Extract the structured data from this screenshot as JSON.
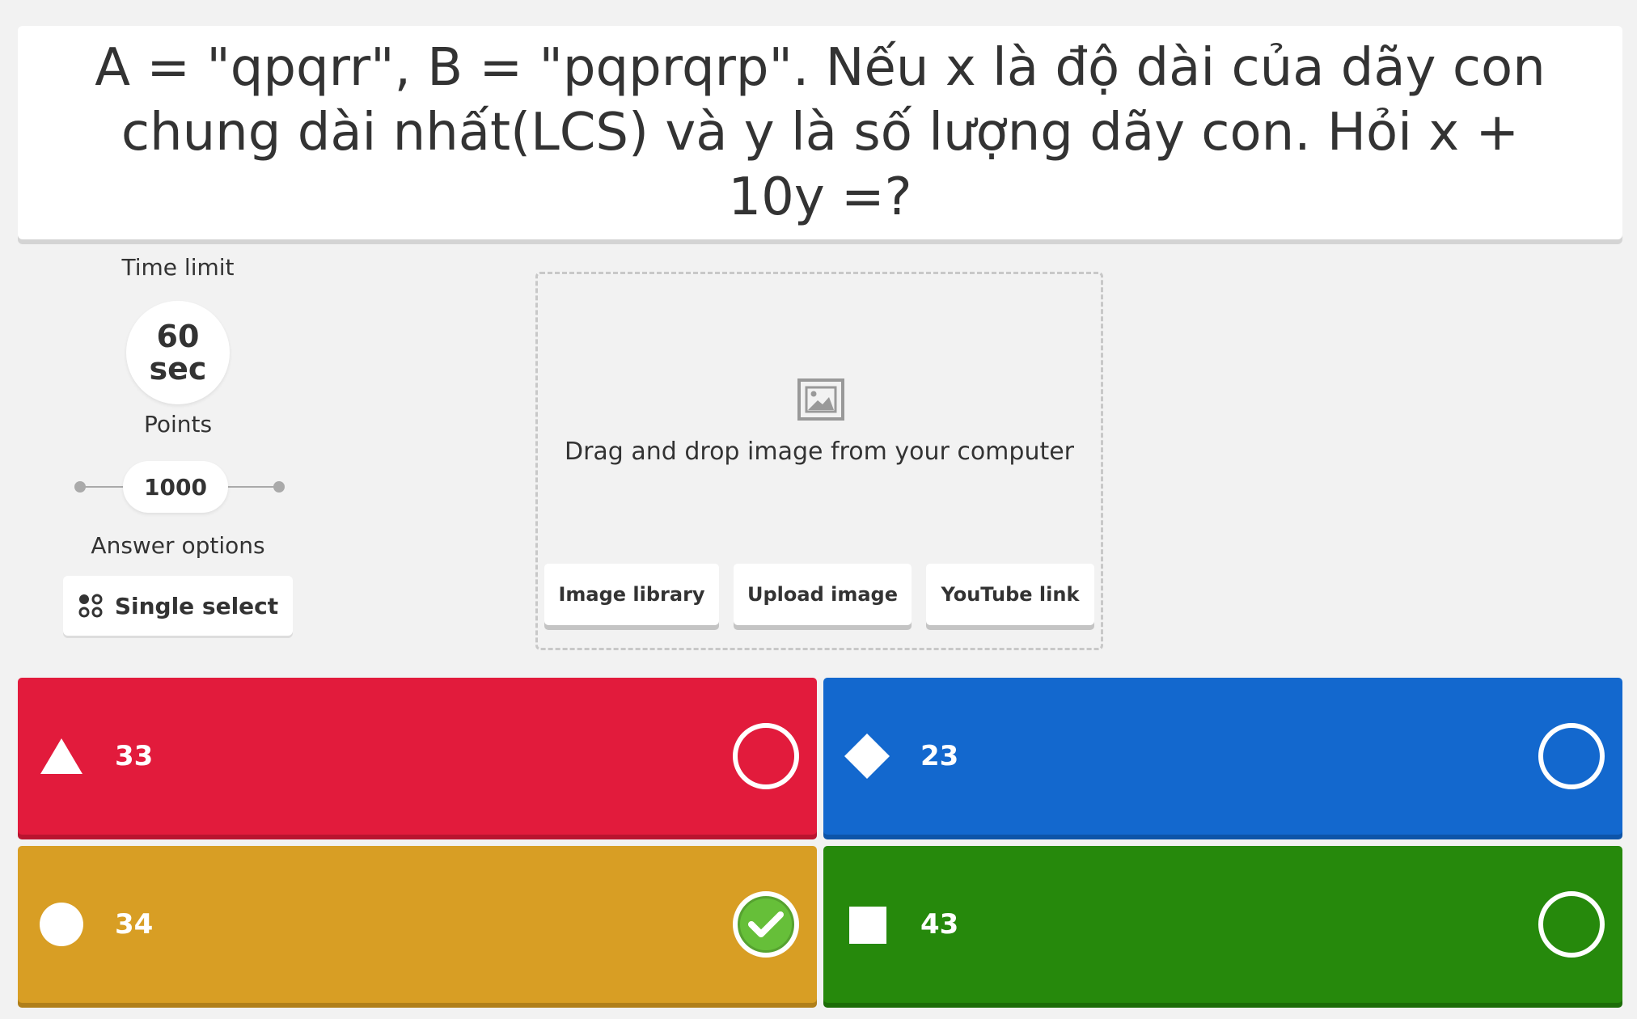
{
  "question": {
    "text": "A = \"qpqrr\", B = \"pqprqrp\". Nếu x là độ dài của dãy con chung dài nhất(LCS) và y là số lượng dãy con. Hỏi x + 10y =?"
  },
  "settings": {
    "time_limit_label": "Time limit",
    "time_value": "60",
    "time_unit": "sec",
    "points_label": "Points",
    "points_value": "1000",
    "answer_options_label": "Answer options",
    "answer_mode": "Single select"
  },
  "media": {
    "drop_text": "Drag and drop image from your computer",
    "buttons": [
      {
        "label": "Image library"
      },
      {
        "label": "Upload image"
      },
      {
        "label": "YouTube link"
      }
    ]
  },
  "answers": [
    {
      "text": "33",
      "shape": "triangle-icon",
      "color": "#e21b3c",
      "correct": false
    },
    {
      "text": "23",
      "shape": "diamond-icon",
      "color": "#1368ce",
      "correct": false
    },
    {
      "text": "34",
      "shape": "circle-icon",
      "color": "#d89e24",
      "correct": true
    },
    {
      "text": "43",
      "shape": "square-icon",
      "color": "#26890c",
      "correct": false
    }
  ]
}
